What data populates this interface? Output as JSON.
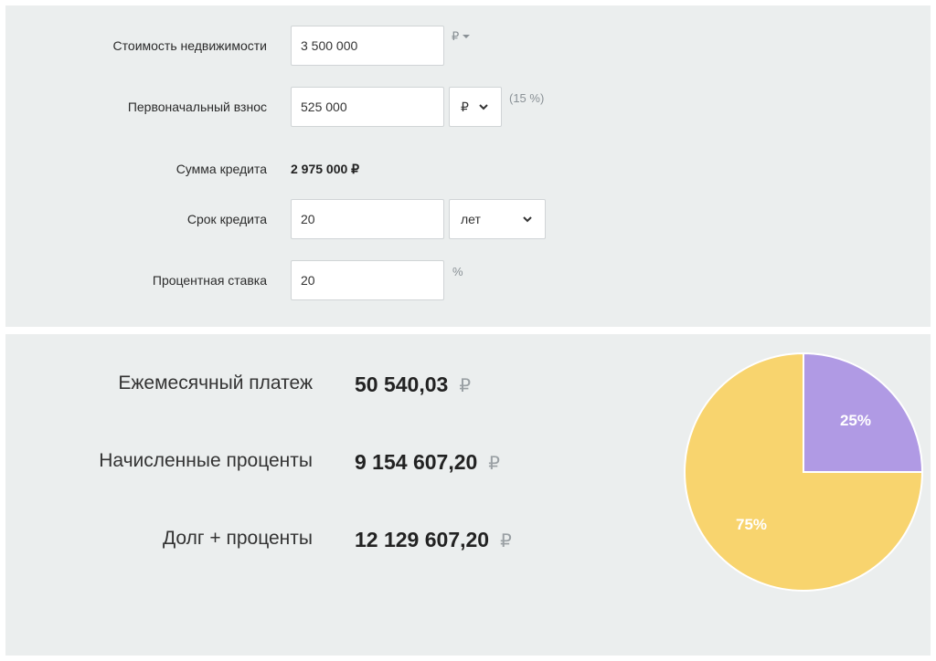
{
  "form": {
    "property_cost": {
      "label": "Стоимость недвижимости",
      "value": "3 500 000",
      "currency": "₽"
    },
    "down_payment": {
      "label": "Первоначальный взнос",
      "value": "525 000",
      "unit_select": "₽",
      "percent_hint": "(15 %)"
    },
    "loan_amount": {
      "label": "Сумма кредита",
      "value": "2 975 000 ₽"
    },
    "loan_term": {
      "label": "Срок кредита",
      "value": "20",
      "unit_select": "лет"
    },
    "interest_rate": {
      "label": "Процентная ставка",
      "value": "20",
      "unit": "%"
    }
  },
  "results": {
    "monthly_payment": {
      "label": "Ежемесячный платеж",
      "value": "50 540,03",
      "currency": "₽"
    },
    "accrued_interest": {
      "label": "Начисленные проценты",
      "value": "9 154 607,20",
      "currency": "₽"
    },
    "debt_plus_interest": {
      "label": "Долг + проценты",
      "value": "12 129 607,20",
      "currency": "₽"
    }
  },
  "chart_data": {
    "type": "pie",
    "slices": [
      {
        "label": "25%",
        "value": 25,
        "color": "#b09ae4"
      },
      {
        "label": "75%",
        "value": 75,
        "color": "#f8d46e"
      }
    ]
  }
}
